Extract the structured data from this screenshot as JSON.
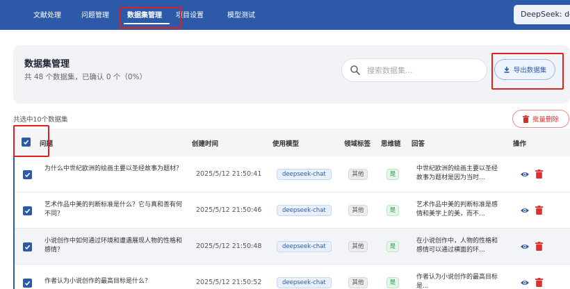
{
  "nav": {
    "items": [
      {
        "label": "文献处理"
      },
      {
        "label": "问题管理"
      },
      {
        "label": "数据集管理"
      },
      {
        "label": "项目设置"
      },
      {
        "label": "模型测试"
      }
    ],
    "model_selector": "DeepSeek: deepseek-chat"
  },
  "header": {
    "title": "数据集管理",
    "summary": "共 48 个数据集，已确认 0 个（0%）",
    "search_placeholder": "搜索数据集...",
    "search_value": "",
    "export_label": "导出数据集"
  },
  "selection": {
    "info": "共选中10个数据集",
    "batch_delete_label": "批量删除"
  },
  "table": {
    "columns": {
      "question": "问题",
      "created": "创建时间",
      "model": "使用模型",
      "domain": "领域标签",
      "cot": "思维链",
      "answer": "回答",
      "actions": "操作"
    },
    "rows": [
      {
        "question": "为什么中世纪欧洲的绘画主要以圣经故事为题材？",
        "created": "2025/5/12 21:50:41",
        "model": "deepseek-chat",
        "domain": "其他",
        "cot": "是",
        "answer": "中世纪欧洲的绘画主要以圣经故事为题材是因为当时..."
      },
      {
        "question": "艺术作品中美的判断标准是什么？它与真和善有何不同？",
        "created": "2025/5/12 21:50:46",
        "model": "deepseek-chat",
        "domain": "其他",
        "cot": "是",
        "answer": "艺术作品中美的判断标准是感情和美学上的美，而不..."
      },
      {
        "question": "小说创作中如何通过环境和遭遇展现人物的性格和感情？",
        "created": "2025/5/12 21:50:48",
        "model": "deepseek-chat",
        "domain": "其他",
        "cot": "是",
        "answer": "在小说创作中，人物的性格和感情可以通过横面的环..."
      },
      {
        "question": "作者认为小说创作的最高目标是什么？",
        "created": "2025/5/12 21:50:52",
        "model": "deepseek-chat",
        "domain": "其他",
        "cot": "是",
        "answer": "作者认为小说创作的最高目标是..."
      }
    ]
  },
  "colors": {
    "primary": "#2d5aa8",
    "danger": "#d0302f",
    "success": "#2f9e4f",
    "highlight": "#e02020"
  }
}
